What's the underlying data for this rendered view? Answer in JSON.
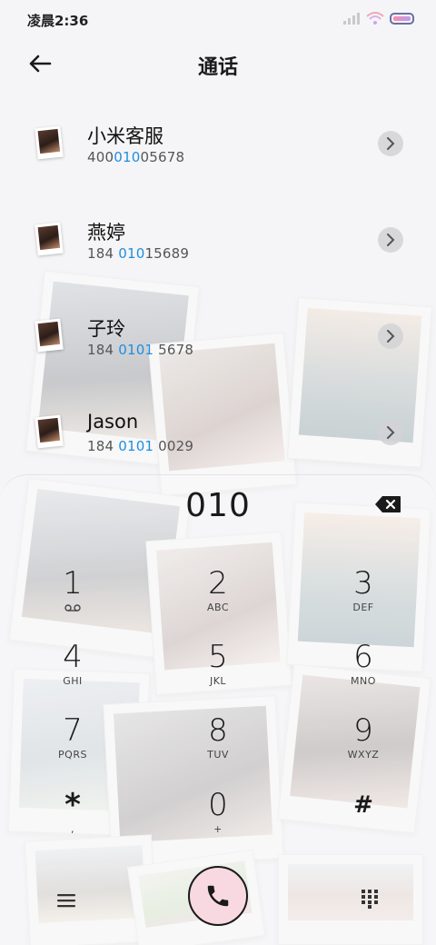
{
  "status_bar": {
    "time": "凌晨2:36",
    "icons": [
      "signal-icon",
      "wifi-icon",
      "battery-icon"
    ],
    "battery_gradient": [
      "#ff8aa8",
      "#b79cf0"
    ]
  },
  "header": {
    "title": "通话",
    "back_icon": "arrow-left-icon"
  },
  "contacts": [
    {
      "name": "小米客服",
      "number_parts": [
        "400",
        "010",
        "05678"
      ]
    },
    {
      "name": "燕婷",
      "number_parts": [
        "184 ",
        "010",
        "15689"
      ]
    },
    {
      "name": "子玲",
      "number_parts": [
        "184 ",
        "0101",
        " 5678"
      ]
    },
    {
      "name": "Jason",
      "number_parts": [
        "184 ",
        "0101",
        " 0029"
      ]
    }
  ],
  "dialer": {
    "display": "010",
    "backspace_icon": "backspace-icon",
    "keys": [
      {
        "digit": "1",
        "letters": ""
      },
      {
        "digit": "2",
        "letters": "ABC"
      },
      {
        "digit": "3",
        "letters": "DEF"
      },
      {
        "digit": "4",
        "letters": "GHI"
      },
      {
        "digit": "5",
        "letters": "JKL"
      },
      {
        "digit": "6",
        "letters": "MNO"
      },
      {
        "digit": "7",
        "letters": "PQRS"
      },
      {
        "digit": "8",
        "letters": "TUV"
      },
      {
        "digit": "9",
        "letters": "WXYZ"
      },
      {
        "digit": "*",
        "letters": ","
      },
      {
        "digit": "0",
        "letters": "+"
      },
      {
        "digit": "#",
        "letters": ""
      }
    ]
  },
  "bottom_bar": {
    "menu_icon": "hamburger-menu-icon",
    "call_icon": "phone-icon",
    "keypad_icon": "dialpad-icon",
    "call_button_color": "#f8d9e2"
  },
  "colors": {
    "highlight": "#1f8ee0",
    "background": "#f3f3f5"
  }
}
